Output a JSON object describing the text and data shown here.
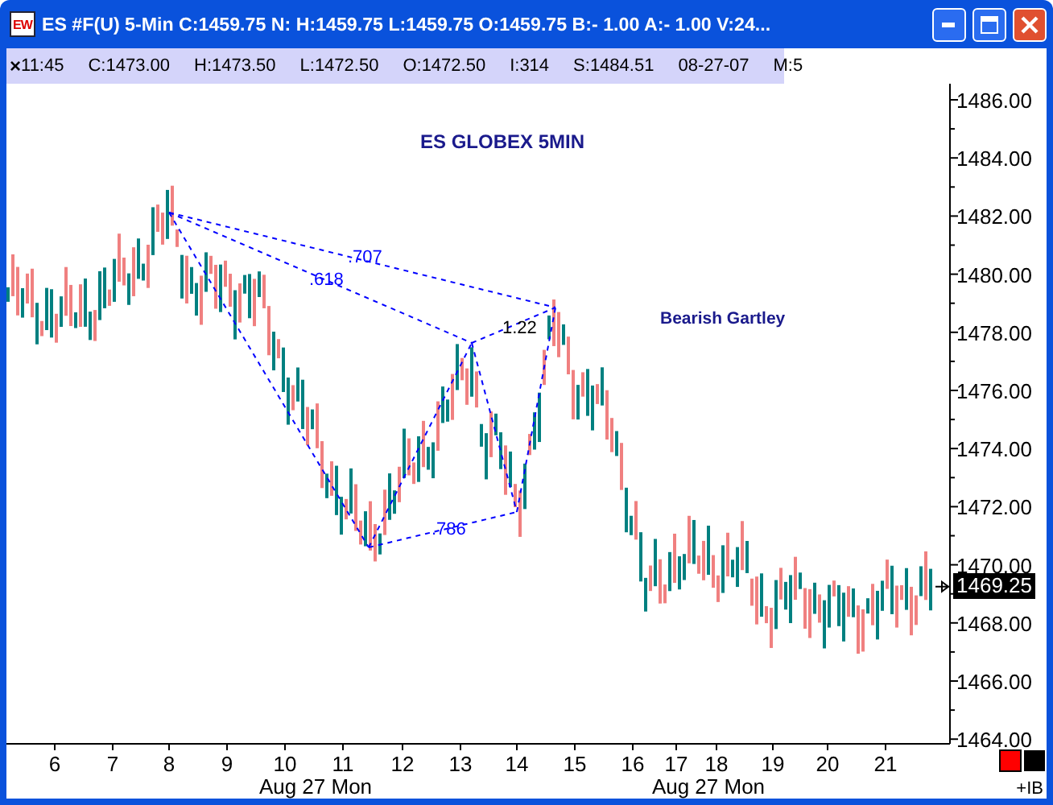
{
  "window": {
    "logo": "EW",
    "title": "ES #F(U) 5-Min C:1459.75 N: H:1459.75 L:1459.75 O:1459.75 B:- 1.00 A:- 1.00 V:24..."
  },
  "info_bar": {
    "close": "×",
    "fields": [
      "11:45",
      "C:1473.00",
      "H:1473.50",
      "L:1472.50",
      "O:1472.50",
      "I:314",
      "S:1484.51",
      "08-27-07",
      "M:5"
    ]
  },
  "chart": {
    "title": "ES GLOBEX 5MIN",
    "pattern_name": "Bearish Gartley",
    "ratios": [
      ".618",
      ".707",
      "1.22",
      ".786"
    ],
    "price_axis": [
      "1486.00",
      "1484.00",
      "1482.00",
      "1480.00",
      "1478.00",
      "1476.00",
      "1474.00",
      "1472.00",
      "1470.00",
      "1468.00",
      "1466.00",
      "1464.00"
    ],
    "last_price": "1469.25",
    "time_axis": [
      "6",
      "7",
      "8",
      "9",
      "10",
      "11",
      "12",
      "13",
      "14",
      "15",
      "16",
      "17",
      "18",
      "19",
      "20",
      "21"
    ],
    "date_labels": [
      "Aug 27 Mon",
      "Aug 27 Mon"
    ],
    "corner_label": "+IB"
  }
}
